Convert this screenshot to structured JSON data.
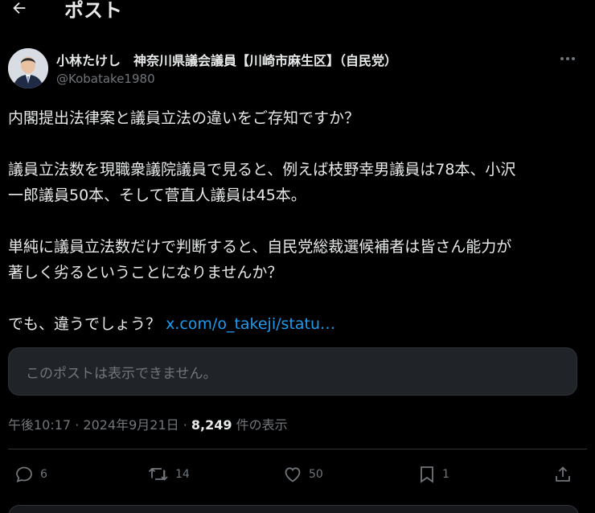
{
  "header": {
    "title": "ポスト",
    "back_icon": "arrow-left-icon"
  },
  "author": {
    "name": "小林たけし　神奈川県議会議員【川崎市麻生区】（自民党）",
    "handle": "@Kobatake1980",
    "more_icon": "more-horizontal-icon"
  },
  "post": {
    "line1": "内閣提出法律案と議員立法の違いをご存知ですか？",
    "line2": "議員立法数を現職衆議院議員で見ると、例えば枝野幸男議員は78本、小沢",
    "line3": "一郎議員50本、そして菅直人議員は45本。",
    "line4": "単純に議員立法数だけで判断すると、自民党総裁選候補者は皆さん能力が",
    "line5": "著しく劣るということになりませんか？",
    "line6": "でも、違うでしょう？",
    "link": "x.com/o_takeji/statu…"
  },
  "quote": {
    "unavailable_text": "このポストは表示できません。"
  },
  "meta": {
    "time": "午後10:17",
    "sep1": " · ",
    "date": "2024年9月21日",
    "sep2": " · ",
    "views_count": "8,249",
    "views_label": " 件の表示"
  },
  "actions": {
    "reply": {
      "icon": "reply-icon",
      "count": "6"
    },
    "repost": {
      "icon": "repost-icon",
      "count": "14"
    },
    "like": {
      "icon": "heart-icon",
      "count": "50"
    },
    "bookmark": {
      "icon": "bookmark-icon",
      "count": "1"
    },
    "share": {
      "icon": "share-icon"
    }
  }
}
